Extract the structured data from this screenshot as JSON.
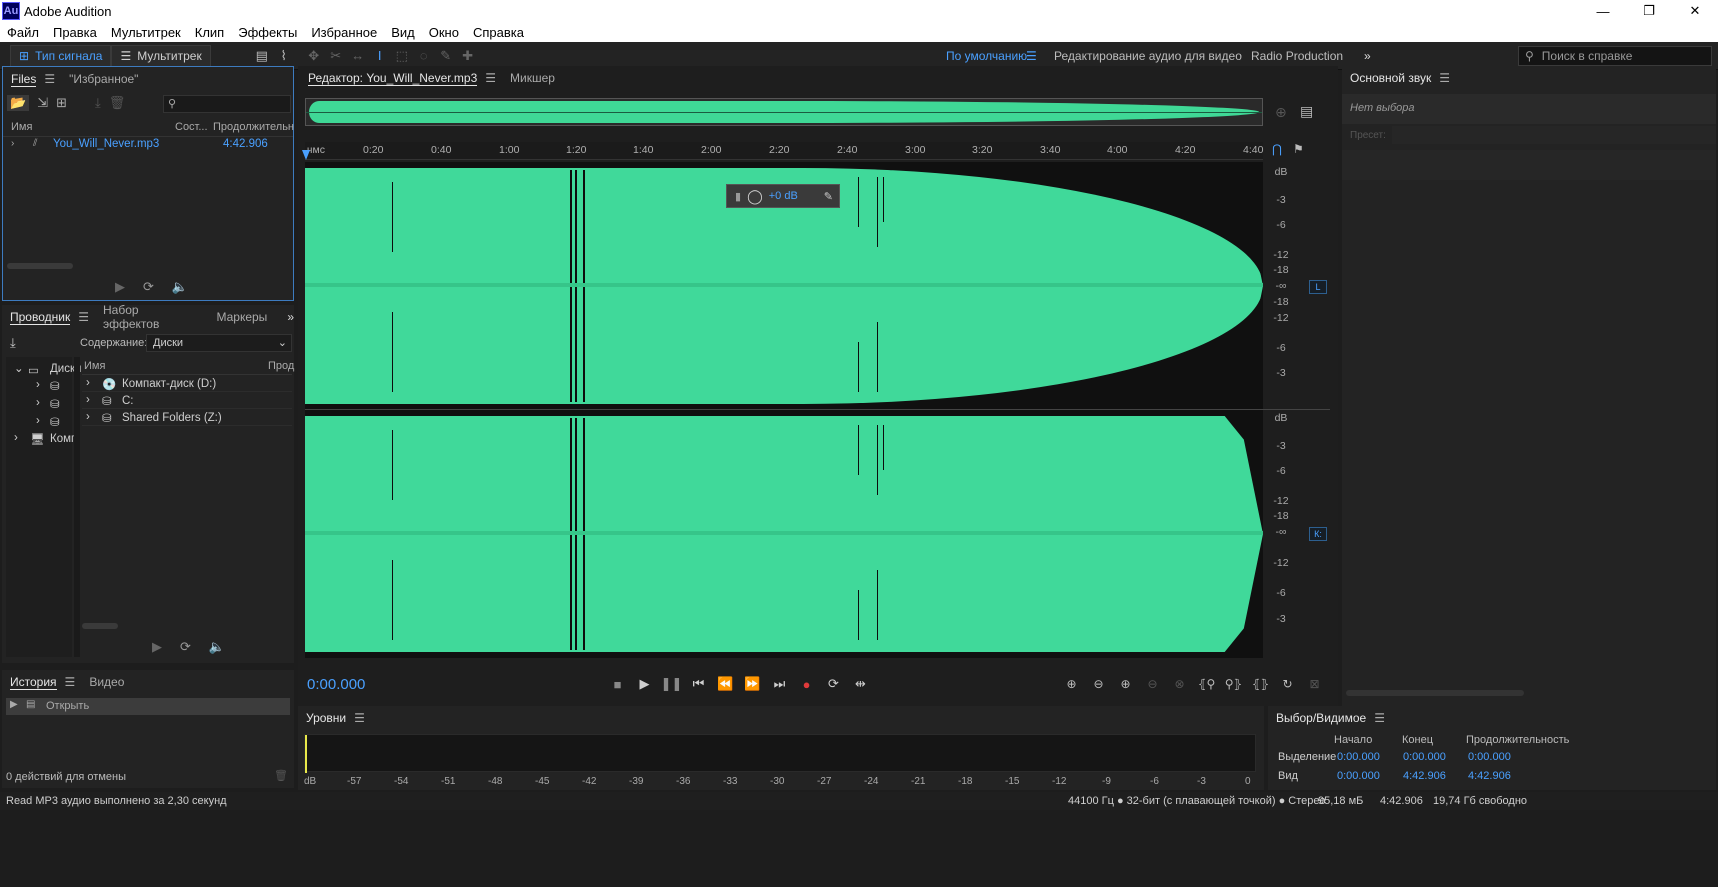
{
  "window": {
    "app_icon": "Au",
    "title": "Adobe Audition",
    "minimize": "—",
    "maximize": "❐",
    "close": "✕"
  },
  "menu": [
    "Файл",
    "Правка",
    "Мультитрек",
    "Клип",
    "Эффекты",
    "Избранное",
    "Вид",
    "Окно",
    "Справка"
  ],
  "toolbar": {
    "mode_waveform": "Тип сигнала",
    "mode_multitrack": "Мультитрек",
    "workspaces": {
      "default": "По умолчанию",
      "video": "Редактирование аудио для видео",
      "radio": "Radio Production"
    },
    "help_search_placeholder": "Поиск в справке"
  },
  "files_panel": {
    "tabs": [
      "Files",
      "\"Избранное\""
    ],
    "columns": {
      "name": "Имя",
      "status": "Сост...",
      "duration": "Продолжительн"
    },
    "file": {
      "name": "You_Will_Never.mp3",
      "duration": "4:42.906"
    }
  },
  "explorer_panel": {
    "tabs": [
      "Проводник",
      "Набор эффектов",
      "Маркеры"
    ],
    "content_label": "Содержание:",
    "content_value": "Диски",
    "tree": [
      "Диски",
      "Комп"
    ],
    "columns": {
      "name": "Имя",
      "size": "Прод"
    },
    "drives": [
      "Компакт-диск (D:)",
      "C:",
      "Shared Folders (Z:)"
    ]
  },
  "history_panel": {
    "tabs": [
      "История",
      "Видео"
    ],
    "item": "Открыть",
    "undo_count": "0 действий для отмены"
  },
  "editor": {
    "tabs": [
      "Редактор: You_Will_Never.mp3",
      "Микшер"
    ],
    "ruler_unit": "чмс",
    "ruler_ticks": [
      "0:20",
      "0:40",
      "1:00",
      "1:20",
      "1:40",
      "2:00",
      "2:20",
      "2:40",
      "3:00",
      "3:20",
      "3:40",
      "4:00",
      "4:20",
      "4:40"
    ],
    "db_labels": [
      "dB",
      "-3",
      "-6",
      "-12",
      "-18",
      "-∞",
      "-18",
      "-12",
      "-6",
      "-3"
    ],
    "channel_top": "L",
    "channel_bottom": "К:",
    "hud_gain": "+0 dB",
    "timecode": "0:00.000",
    "waveform_color": "#40d99a"
  },
  "essential_sound": {
    "title": "Основной звук",
    "no_selection": "Нет выбора",
    "preset_label": "Пресет:"
  },
  "levels_panel": {
    "title": "Уровни",
    "scale": [
      "dB",
      "-57",
      "-54",
      "-51",
      "-48",
      "-45",
      "-42",
      "-39",
      "-36",
      "-33",
      "-30",
      "-27",
      "-24",
      "-21",
      "-18",
      "-15",
      "-12",
      "-9",
      "-6",
      "-3",
      "0"
    ]
  },
  "selection_panel": {
    "title": "Выбор/Видимое",
    "columns": [
      "Начало",
      "Конец",
      "Продолжительность"
    ],
    "rows": [
      {
        "label": "Выделение",
        "start": "0:00.000",
        "end": "0:00.000",
        "duration": "0:00.000"
      },
      {
        "label": "Вид",
        "start": "0:00.000",
        "end": "4:42.906",
        "duration": "4:42.906"
      }
    ]
  },
  "status": {
    "message": "Read MP3 аудио выполнено за 2,30 секунд",
    "format": "44100 Гц ● 32-бит (с плавающей точкой) ● Стерео",
    "size": "95,18 мБ",
    "duration": "4:42.906",
    "free": "19,74 Гб свободно"
  }
}
